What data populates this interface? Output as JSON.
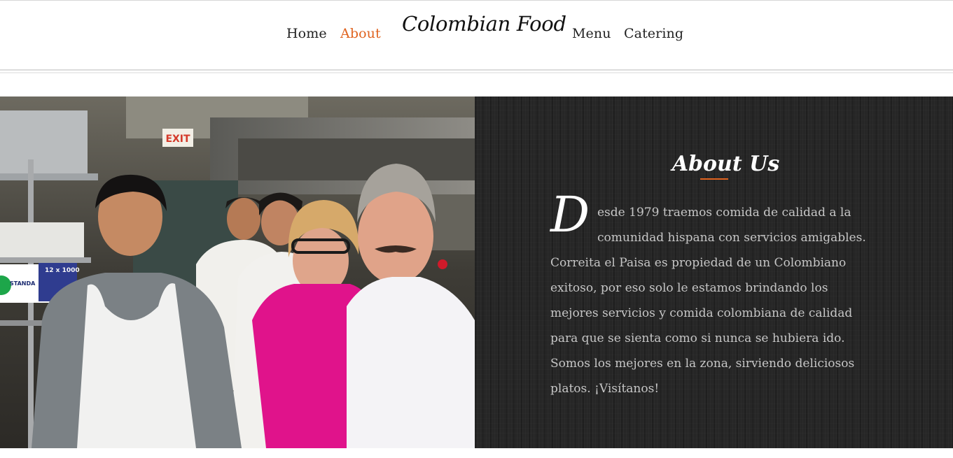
{
  "nav": {
    "links": [
      {
        "label": "Home",
        "active": false
      },
      {
        "label": "About",
        "active": true
      },
      {
        "label": "Menu",
        "active": false
      },
      {
        "label": "Catering",
        "active": false
      }
    ],
    "brand": "Colombian Food"
  },
  "colors": {
    "accent": "#e0631f",
    "panel_background": "#262626",
    "text_light": "#c6c6c6",
    "white": "#ffffff"
  },
  "photo": {
    "sign_text": "EXIT",
    "box_label": "STANDA",
    "box_count": "12 x 1000"
  },
  "about": {
    "title": "About Us",
    "drop_cap": "D",
    "body": "esde 1979 traemos comida de calidad a la comunidad hispana con servicios amigables. Correita el Paisa es propiedad de un Colombiano exitoso, por eso solo le estamos brindando los mejores servicios y comida colombiana de calidad para que se sienta como si nunca se hubiera ido. Somos los mejores en la zona, sirviendo deliciosos platos. ¡Visítanos!"
  }
}
